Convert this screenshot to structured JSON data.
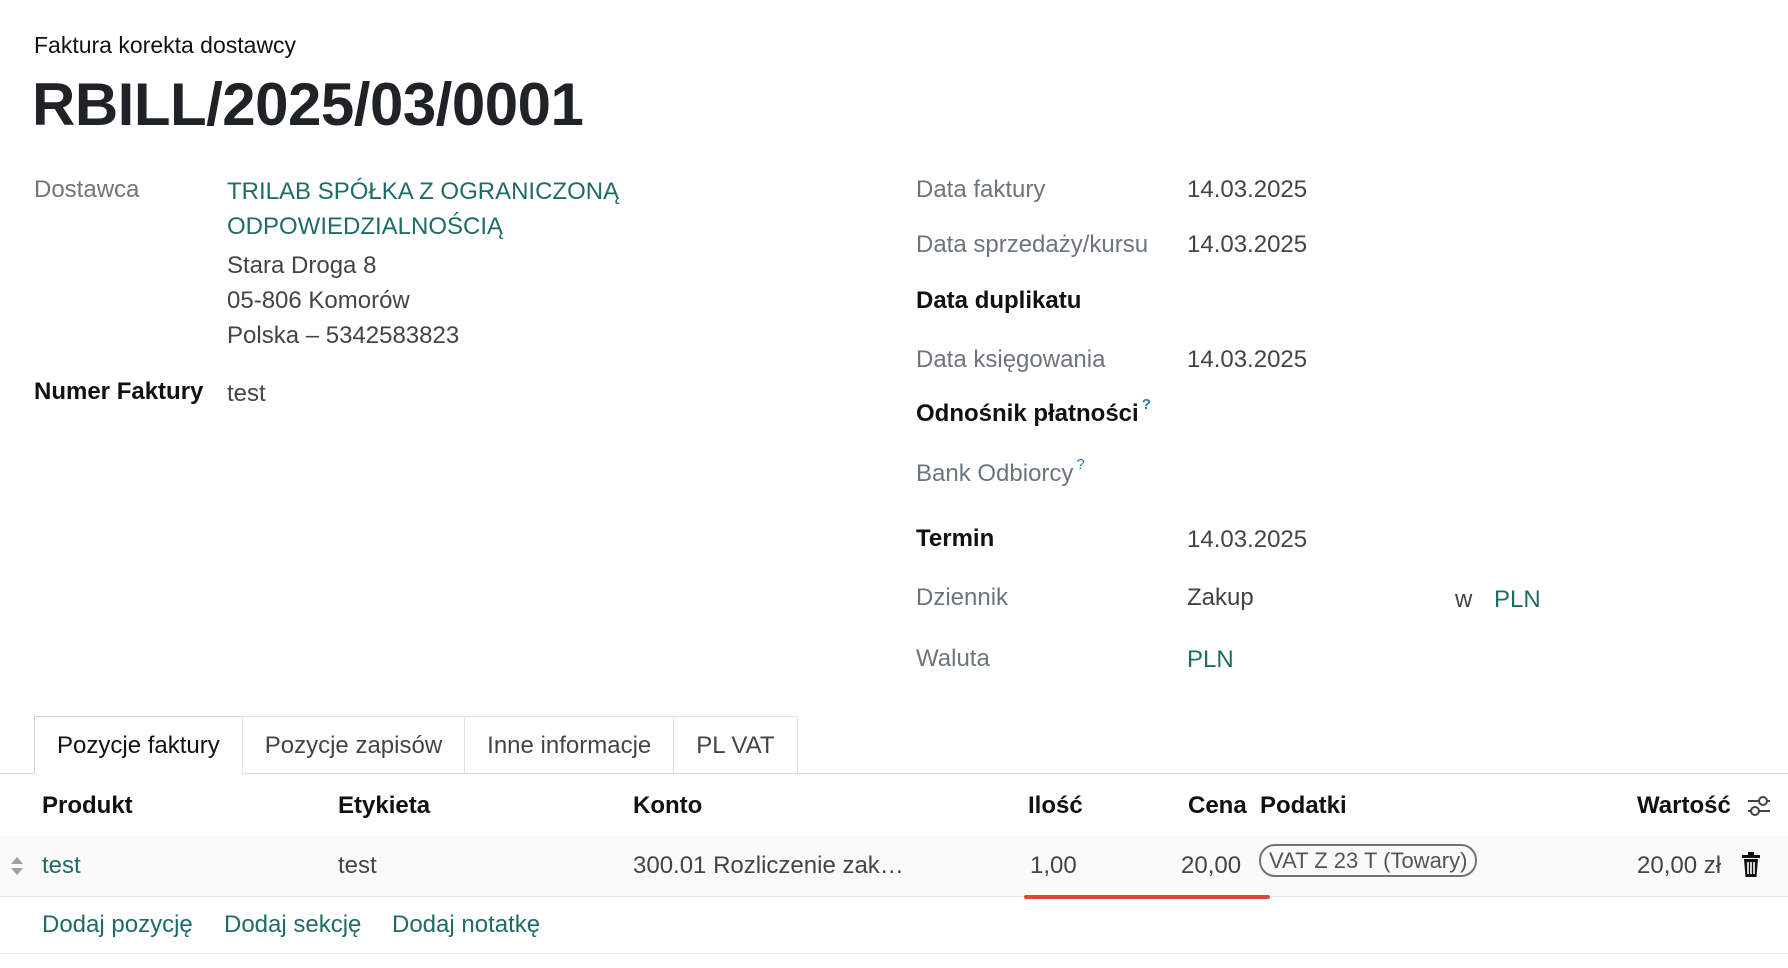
{
  "header": {
    "subtitle": "Faktura korekta dostawcy",
    "title": "RBILL/2025/03/0001"
  },
  "vendor": {
    "label": "Dostawca",
    "name_line1": "TRILAB SPÓŁKA Z OGRANICZONĄ",
    "name_line2": "ODPOWIEDZIALNOŚCIĄ",
    "address_line1": "Stara Droga 8",
    "address_line2": "05-806 Komorów",
    "address_line3": "Polska – 5342583823"
  },
  "invoice_number": {
    "label": "Numer Faktury",
    "value": "test"
  },
  "right_fields": {
    "invoice_date": {
      "label": "Data faktury",
      "value": "14.03.2025"
    },
    "sale_date": {
      "label": "Data sprzedaży/kursu",
      "value": "14.03.2025"
    },
    "duplicate_date": {
      "label": "Data duplikatu",
      "value": ""
    },
    "posting_date": {
      "label": "Data księgowania",
      "value": "14.03.2025"
    },
    "payment_ref": {
      "label": "Odnośnik płatności",
      "help": "?"
    },
    "recipient_bank": {
      "label": "Bank Odbiorcy",
      "help": "?"
    },
    "due": {
      "label": "Termin",
      "value": "14.03.2025"
    },
    "journal": {
      "label": "Dziennik",
      "value": "Zakup",
      "in_word": "w",
      "currency": "PLN"
    },
    "currency": {
      "label": "Waluta",
      "value": "PLN"
    }
  },
  "tabs": [
    {
      "label": "Pozycje faktury"
    },
    {
      "label": "Pozycje zapisów"
    },
    {
      "label": "Inne informacje"
    },
    {
      "label": "PL VAT"
    }
  ],
  "table": {
    "headers": {
      "product": "Produkt",
      "label": "Etykieta",
      "account": "Konto",
      "qty": "Ilość",
      "price": "Cena",
      "taxes": "Podatki",
      "amount": "Wartość"
    },
    "rows": [
      {
        "product": "test",
        "label": "test",
        "account": "300.01 Rozliczenie zak…",
        "qty": "1,00",
        "price": "20,00",
        "tax": "VAT Z 23 T (Towary)",
        "amount": "20,00 zł"
      }
    ],
    "actions": {
      "add_line": "Dodaj pozycję",
      "add_section": "Dodaj sekcję",
      "add_note": "Dodaj notatkę"
    }
  },
  "colors": {
    "link": "#1f6c66",
    "muted": "#6c757d",
    "highlight": "#d64a36"
  },
  "icons": [
    "sort-handle-icon",
    "column-settings-icon",
    "trash-icon"
  ]
}
